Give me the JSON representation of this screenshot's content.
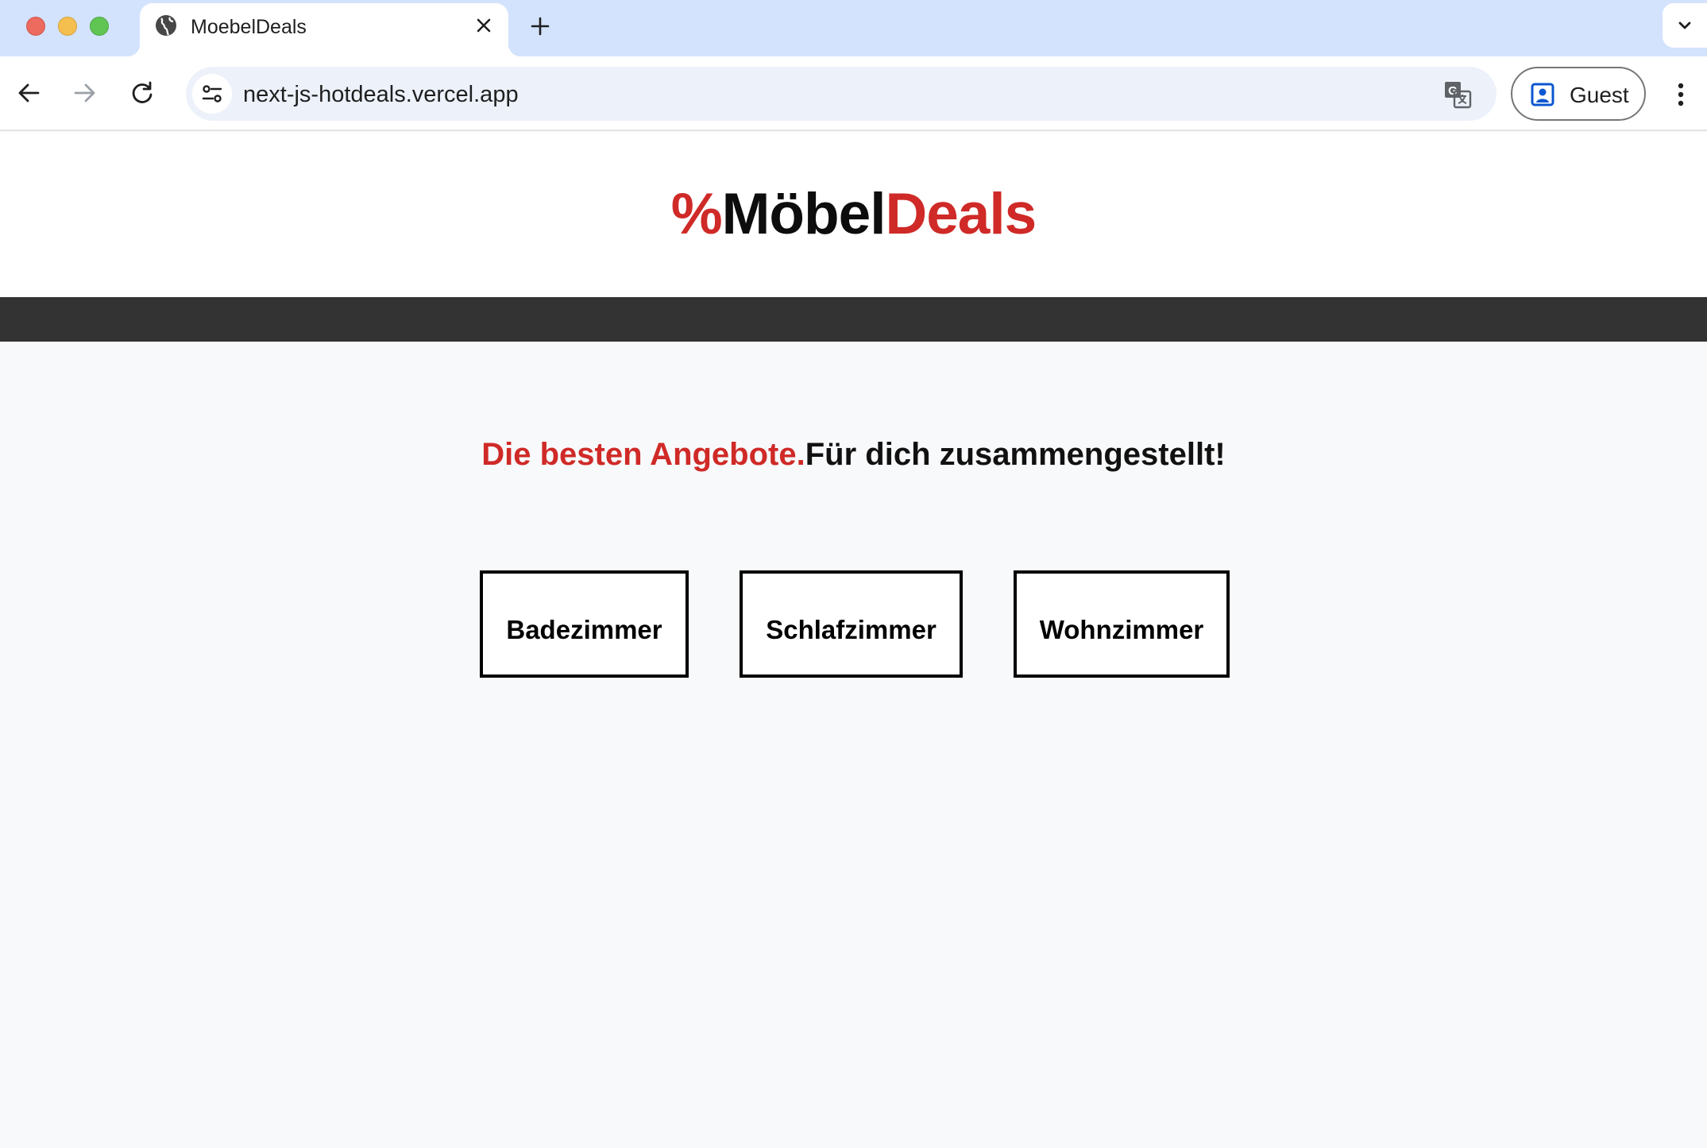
{
  "browser": {
    "tab_title": "MoebelDeals",
    "url": "next-js-hotdeals.vercel.app",
    "profile_label": "Guest"
  },
  "site": {
    "logo": {
      "percent": "%",
      "brand_black": "Möbel",
      "brand_red": "Deals"
    },
    "tagline": {
      "red_part": "Die besten Angebote.",
      "black_part": "Für dich zusammengestellt!"
    },
    "categories": [
      {
        "label": "Badezimmer"
      },
      {
        "label": "Schlafzimmer"
      },
      {
        "label": "Wohnzimmer"
      }
    ]
  },
  "colors": {
    "brand_red": "#cf2a27",
    "navbar": "#333333",
    "tabstrip": "#d3e3fd",
    "page_bg": "#f8f9fb"
  },
  "icons": [
    "globe-icon",
    "close-icon",
    "plus-icon",
    "chevron-down-icon",
    "back-arrow-icon",
    "forward-arrow-icon",
    "reload-icon",
    "site-settings-icon",
    "translate-icon",
    "profile-icon",
    "more-vert-icon"
  ]
}
